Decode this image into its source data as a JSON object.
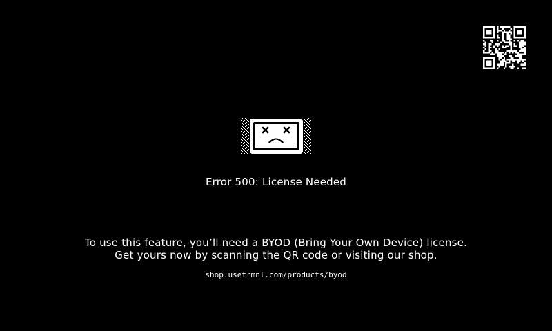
{
  "qr_code": {
    "icon": "qr-code-icon"
  },
  "device_icon": {
    "icon": "sad-device-icon"
  },
  "error": {
    "title": "Error 500: License Needed"
  },
  "message": {
    "line1": "To use this feature, you’ll need a BYOD (Bring Your Own Device) license.",
    "line2": "Get yours now by scanning the QR code or visiting our shop."
  },
  "shop": {
    "url": "shop.usetrmnl.com/products/byod"
  },
  "colors": {
    "background": "#000000",
    "foreground": "#ffffff"
  }
}
